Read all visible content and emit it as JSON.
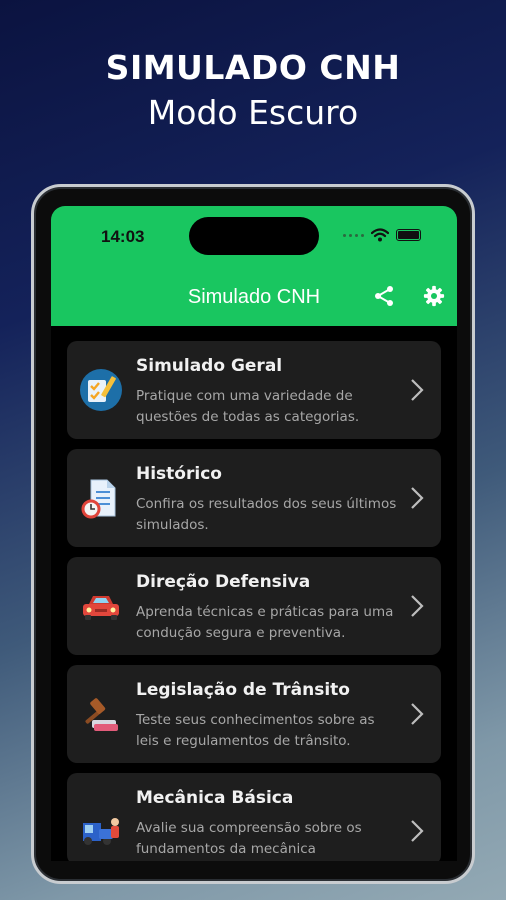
{
  "promo": {
    "title": "SIMULADO CNH",
    "subtitle": "Modo Escuro"
  },
  "status_bar": {
    "time": "14:03"
  },
  "app_bar": {
    "title": "Simulado CNH",
    "actions": [
      "share-icon",
      "gear-icon"
    ]
  },
  "menu": [
    {
      "title": "Simulado Geral",
      "desc": "Pratique com uma variedade de questões de todas as categorias.",
      "icon": "checklist-icon"
    },
    {
      "title": "Histórico",
      "desc": "Confira os resultados dos seus últimos simulados.",
      "icon": "history-document-icon"
    },
    {
      "title": "Direção Defensiva",
      "desc": "Aprenda técnicas e práticas para uma condução segura e preventiva.",
      "icon": "car-icon"
    },
    {
      "title": "Legislação de Trânsito",
      "desc": "Teste seus conhecimentos sobre as leis e regulamentos de trânsito.",
      "icon": "gavel-icon"
    },
    {
      "title": "Mecânica Básica",
      "desc": "Avalie sua compreensão sobre os fundamentos da mecânica",
      "icon": "mechanic-icon"
    }
  ],
  "colors": {
    "accent": "#19c660",
    "card": "#1e1e1e",
    "background": "#000000"
  }
}
